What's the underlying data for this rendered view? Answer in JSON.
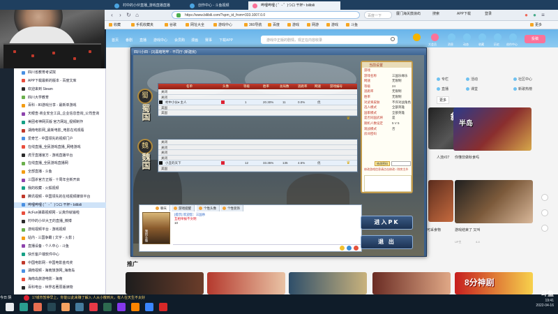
{
  "browser": {
    "tabs": [
      {
        "label": "村中的小伙直播_游戏直播直播",
        "active": false
      },
      {
        "label": "创作中心 - 斗鱼视频",
        "active": false
      },
      {
        "label": "哔哩哔哩 ( ゜- ゜)つロ 干杯~ bilibili",
        "active": true
      }
    ],
    "url": "https://www.bilibili.com/?spm_id_from=333.1007.0.0",
    "search_hint": "百度一下",
    "bookmarks": [
      "收藏",
      "手机收藏夹",
      "谷歌",
      "网址大全",
      "游戏中心",
      "360导航",
      "百度",
      "游戏",
      "网游",
      "游戏",
      "斗鱼",
      "更多"
    ],
    "right_links": [
      "厦门海关鼓浪屿",
      "搜索",
      "APP下载",
      "登录"
    ]
  },
  "sidebar": {
    "items": [
      "四川省教育考试院",
      "APP下载最新的版本 - 百度文库",
      "欢迎来到 Steam",
      "四川大学教育",
      "百科 - 80游戏分享 - 最新单游戏",
      "天眼查-商业安全工具_企业信息查询_公司查询",
      "美团考神网页版 官方网站_视频制作",
      "湖南电影网_最新电影_电影在线观看",
      "爱奇艺 - 中国领先的视频门户",
      "在线直播_全民游戏直播_网络游戏",
      "虎牙直播官方 - 游戏直播平台",
      "在线直播_全民游戏直播网",
      "全部直播 - 斗鱼",
      "三国杀官方正版 - 十周年全新开启",
      "我的收藏 - 火狐视频",
      "腾讯视频 - 中国领先的在线视频媒体平台",
      "哔哩哔哩 ( ゜- ゜)つロ 干杯~ bilibili",
      "AcFun弹幕视频网 - 认真你就输啦",
      "村中的小伙大王的直播_微博",
      "游戏视频平台 - 游戏视频",
      "站内 - 三国争霸 ( 文字 - 火影 )",
      "直播设备 - 个人中心 - 斗鱼",
      "快乐客户端软件中心",
      "中国电影网 - 中国电影金鸡奖",
      "湖南视频 - 海南旅游网_海南岛",
      "海南岛旅游电影 - 海南",
      "百科电台 - 世界名著原版读物"
    ],
    "active_index": 16
  },
  "site": {
    "nav": [
      "首页",
      "番剧",
      "直播",
      "游戏中心",
      "会员购",
      "漫画",
      "赛事",
      "下载APP"
    ],
    "search_placeholder": "游戏中正版的剧情，现正在内容收录",
    "header_icons": [
      "大会员",
      "消息",
      "动态",
      "收藏",
      "历史",
      "创作中心"
    ],
    "upload_label": "投稿",
    "categories": [
      "专栏",
      "活动",
      "社区中心",
      "直播",
      "课堂",
      "新歌热榜"
    ],
    "more_label": "更多",
    "recommend_label": "推广",
    "video_titles": [
      "人流#27",
      "你懂非做秋食吗",
      "游戏结束了 又叫",
      "可采食物"
    ],
    "video_subs": [
      "UP主",
      "4-4"
    ],
    "thumb_texts": [
      "8分神剧",
      "半岛",
      "斜金"
    ]
  },
  "game": {
    "window_title": "四川小四 - (3)黑暗地牢 - 不同厅 (新建房)",
    "seat_headers": [
      "名单",
      "头像",
      "等级",
      "胜率",
      "总局数",
      "逃跑率",
      "网速",
      "游戏编号"
    ],
    "kingdoms": [
      {
        "name": "蜀国",
        "emblem": "蜀"
      },
      {
        "name": "魏国",
        "emblem": "魏"
      }
    ],
    "shu_seats": [
      "关闭",
      "关闭",
      "村中小伙♦ 主人",
      "美国",
      "美国"
    ],
    "wei_seats": [
      "关闭",
      "关闭",
      "关闭",
      "关闭",
      "小丑的天下",
      "美国"
    ],
    "shu_player": {
      "name": "村中小伙♦ 主人",
      "level": "1",
      "win": "20.30%",
      "games": "11",
      "flee": "0.0%",
      "net": "优"
    },
    "wei_player": {
      "name": "小丑的天下",
      "level": "12",
      "win": "33.35%",
      "games": "135",
      "flee": "4.5%",
      "net": "优"
    },
    "info_title": "当前设置",
    "info_rows": [
      {
        "k": "游戏",
        "v": ""
      },
      {
        "k": "游戏名称",
        "v": "三国乐缘乐"
      },
      {
        "k": "网速",
        "v": "无限制"
      },
      {
        "k": "等级",
        "v": "24"
      },
      {
        "k": "逃跑率",
        "v": "无限制"
      },
      {
        "k": "胜率",
        "v": "无限制"
      },
      {
        "k": "对武将皮肤",
        "v": "不许对战角色"
      },
      {
        "k": "选人模式",
        "v": "全部英雄"
      },
      {
        "k": "国家模式",
        "v": "全部英雄"
      },
      {
        "k": "是否同国武将",
        "v": "是"
      },
      {
        "k": "随机人数设定",
        "v": "5 V 5"
      },
      {
        "k": "观战模式",
        "v": "否"
      },
      {
        "k": "房间密码",
        "v": ""
      }
    ],
    "pw_button": "修改密码",
    "hint": "修改游戏信息请点击修改 / 除房主外",
    "chat_tabs": [
      "聊天",
      "游戏提醒",
      "个性头像",
      "个性装饰"
    ],
    "chat_lines": [
      {
        "cls": "sys",
        "text": "[提示] 欢迎您：三国杀"
      },
      {
        "cls": "warn",
        "text": "互相举报不文明"
      },
      {
        "cls": "",
        "text": "10"
      }
    ],
    "portrait_label": "我的头像",
    "enter_button": "进入PK",
    "exit_button": "退 出"
  },
  "taskbar": {
    "weather": "今日 阴",
    "notice": "17城市暂停早上，你能以此来赚了解入 人从小散到大，有人在天生不太好",
    "time": "19:41",
    "date": "2022-04-16",
    "watermark": "斗鱼"
  }
}
